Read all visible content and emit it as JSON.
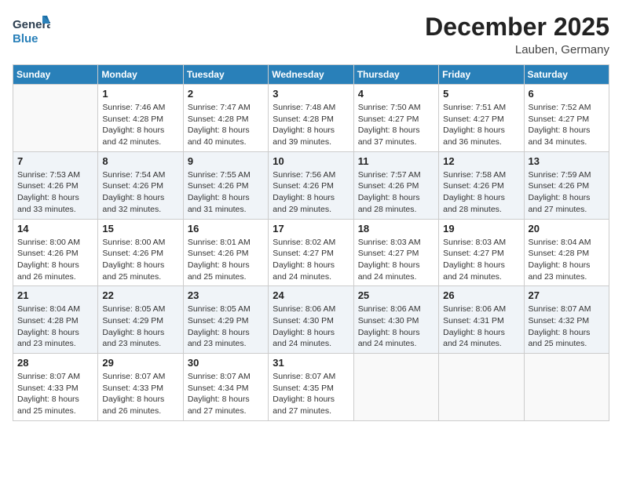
{
  "logo": {
    "general": "General",
    "blue": "Blue"
  },
  "title": "December 2025",
  "location": "Lauben, Germany",
  "days_header": [
    "Sunday",
    "Monday",
    "Tuesday",
    "Wednesday",
    "Thursday",
    "Friday",
    "Saturday"
  ],
  "weeks": [
    [
      {
        "day": "",
        "sunrise": "",
        "sunset": "",
        "daylight": ""
      },
      {
        "day": "1",
        "sunrise": "Sunrise: 7:46 AM",
        "sunset": "Sunset: 4:28 PM",
        "daylight": "Daylight: 8 hours and 42 minutes."
      },
      {
        "day": "2",
        "sunrise": "Sunrise: 7:47 AM",
        "sunset": "Sunset: 4:28 PM",
        "daylight": "Daylight: 8 hours and 40 minutes."
      },
      {
        "day": "3",
        "sunrise": "Sunrise: 7:48 AM",
        "sunset": "Sunset: 4:28 PM",
        "daylight": "Daylight: 8 hours and 39 minutes."
      },
      {
        "day": "4",
        "sunrise": "Sunrise: 7:50 AM",
        "sunset": "Sunset: 4:27 PM",
        "daylight": "Daylight: 8 hours and 37 minutes."
      },
      {
        "day": "5",
        "sunrise": "Sunrise: 7:51 AM",
        "sunset": "Sunset: 4:27 PM",
        "daylight": "Daylight: 8 hours and 36 minutes."
      },
      {
        "day": "6",
        "sunrise": "Sunrise: 7:52 AM",
        "sunset": "Sunset: 4:27 PM",
        "daylight": "Daylight: 8 hours and 34 minutes."
      }
    ],
    [
      {
        "day": "7",
        "sunrise": "Sunrise: 7:53 AM",
        "sunset": "Sunset: 4:26 PM",
        "daylight": "Daylight: 8 hours and 33 minutes."
      },
      {
        "day": "8",
        "sunrise": "Sunrise: 7:54 AM",
        "sunset": "Sunset: 4:26 PM",
        "daylight": "Daylight: 8 hours and 32 minutes."
      },
      {
        "day": "9",
        "sunrise": "Sunrise: 7:55 AM",
        "sunset": "Sunset: 4:26 PM",
        "daylight": "Daylight: 8 hours and 31 minutes."
      },
      {
        "day": "10",
        "sunrise": "Sunrise: 7:56 AM",
        "sunset": "Sunset: 4:26 PM",
        "daylight": "Daylight: 8 hours and 29 minutes."
      },
      {
        "day": "11",
        "sunrise": "Sunrise: 7:57 AM",
        "sunset": "Sunset: 4:26 PM",
        "daylight": "Daylight: 8 hours and 28 minutes."
      },
      {
        "day": "12",
        "sunrise": "Sunrise: 7:58 AM",
        "sunset": "Sunset: 4:26 PM",
        "daylight": "Daylight: 8 hours and 28 minutes."
      },
      {
        "day": "13",
        "sunrise": "Sunrise: 7:59 AM",
        "sunset": "Sunset: 4:26 PM",
        "daylight": "Daylight: 8 hours and 27 minutes."
      }
    ],
    [
      {
        "day": "14",
        "sunrise": "Sunrise: 8:00 AM",
        "sunset": "Sunset: 4:26 PM",
        "daylight": "Daylight: 8 hours and 26 minutes."
      },
      {
        "day": "15",
        "sunrise": "Sunrise: 8:00 AM",
        "sunset": "Sunset: 4:26 PM",
        "daylight": "Daylight: 8 hours and 25 minutes."
      },
      {
        "day": "16",
        "sunrise": "Sunrise: 8:01 AM",
        "sunset": "Sunset: 4:26 PM",
        "daylight": "Daylight: 8 hours and 25 minutes."
      },
      {
        "day": "17",
        "sunrise": "Sunrise: 8:02 AM",
        "sunset": "Sunset: 4:27 PM",
        "daylight": "Daylight: 8 hours and 24 minutes."
      },
      {
        "day": "18",
        "sunrise": "Sunrise: 8:03 AM",
        "sunset": "Sunset: 4:27 PM",
        "daylight": "Daylight: 8 hours and 24 minutes."
      },
      {
        "day": "19",
        "sunrise": "Sunrise: 8:03 AM",
        "sunset": "Sunset: 4:27 PM",
        "daylight": "Daylight: 8 hours and 24 minutes."
      },
      {
        "day": "20",
        "sunrise": "Sunrise: 8:04 AM",
        "sunset": "Sunset: 4:28 PM",
        "daylight": "Daylight: 8 hours and 23 minutes."
      }
    ],
    [
      {
        "day": "21",
        "sunrise": "Sunrise: 8:04 AM",
        "sunset": "Sunset: 4:28 PM",
        "daylight": "Daylight: 8 hours and 23 minutes."
      },
      {
        "day": "22",
        "sunrise": "Sunrise: 8:05 AM",
        "sunset": "Sunset: 4:29 PM",
        "daylight": "Daylight: 8 hours and 23 minutes."
      },
      {
        "day": "23",
        "sunrise": "Sunrise: 8:05 AM",
        "sunset": "Sunset: 4:29 PM",
        "daylight": "Daylight: 8 hours and 23 minutes."
      },
      {
        "day": "24",
        "sunrise": "Sunrise: 8:06 AM",
        "sunset": "Sunset: 4:30 PM",
        "daylight": "Daylight: 8 hours and 24 minutes."
      },
      {
        "day": "25",
        "sunrise": "Sunrise: 8:06 AM",
        "sunset": "Sunset: 4:30 PM",
        "daylight": "Daylight: 8 hours and 24 minutes."
      },
      {
        "day": "26",
        "sunrise": "Sunrise: 8:06 AM",
        "sunset": "Sunset: 4:31 PM",
        "daylight": "Daylight: 8 hours and 24 minutes."
      },
      {
        "day": "27",
        "sunrise": "Sunrise: 8:07 AM",
        "sunset": "Sunset: 4:32 PM",
        "daylight": "Daylight: 8 hours and 25 minutes."
      }
    ],
    [
      {
        "day": "28",
        "sunrise": "Sunrise: 8:07 AM",
        "sunset": "Sunset: 4:33 PM",
        "daylight": "Daylight: 8 hours and 25 minutes."
      },
      {
        "day": "29",
        "sunrise": "Sunrise: 8:07 AM",
        "sunset": "Sunset: 4:33 PM",
        "daylight": "Daylight: 8 hours and 26 minutes."
      },
      {
        "day": "30",
        "sunrise": "Sunrise: 8:07 AM",
        "sunset": "Sunset: 4:34 PM",
        "daylight": "Daylight: 8 hours and 27 minutes."
      },
      {
        "day": "31",
        "sunrise": "Sunrise: 8:07 AM",
        "sunset": "Sunset: 4:35 PM",
        "daylight": "Daylight: 8 hours and 27 minutes."
      },
      {
        "day": "",
        "sunrise": "",
        "sunset": "",
        "daylight": ""
      },
      {
        "day": "",
        "sunrise": "",
        "sunset": "",
        "daylight": ""
      },
      {
        "day": "",
        "sunrise": "",
        "sunset": "",
        "daylight": ""
      }
    ]
  ]
}
